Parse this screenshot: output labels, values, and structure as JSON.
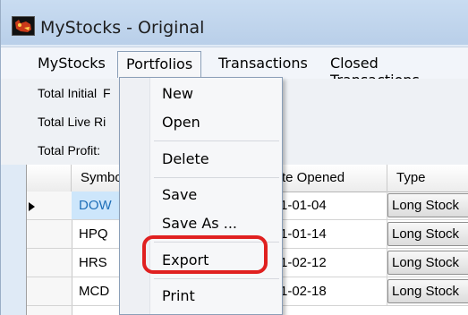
{
  "window": {
    "title": "MyStocks - Original"
  },
  "menubar": {
    "items": [
      "MyStocks",
      "Portfolios",
      "Transactions",
      "Closed Transactions"
    ]
  },
  "info": {
    "total_initial": "Total Initial",
    "total_initial_partial": "F",
    "total_live": "Total Live Ri",
    "total_profit": "Total Profit:"
  },
  "grid": {
    "headers": {
      "symbol": "Symbo",
      "date": "te Opened",
      "type": "Type"
    },
    "rows": [
      {
        "symbol": "DOW",
        "date": "1-01-04",
        "type": "Long Stock",
        "selected": true
      },
      {
        "symbol": "HPQ",
        "date": "1-01-14",
        "type": "Long Stock"
      },
      {
        "symbol": "HRS",
        "date": "1-02-12",
        "type": "Long Stock"
      },
      {
        "symbol": "MCD",
        "date": "1-02-18",
        "type": "Long Stock"
      }
    ]
  },
  "portfolios_menu": {
    "items": [
      "New",
      "Open",
      "Delete",
      "Save",
      "Save As ...",
      "Export",
      "Print"
    ],
    "highlighted": "Export"
  },
  "colors": {
    "highlight_ring": "#e02020",
    "selected_cell": "#cde6fb",
    "title_bar": "#c9dcf1"
  }
}
